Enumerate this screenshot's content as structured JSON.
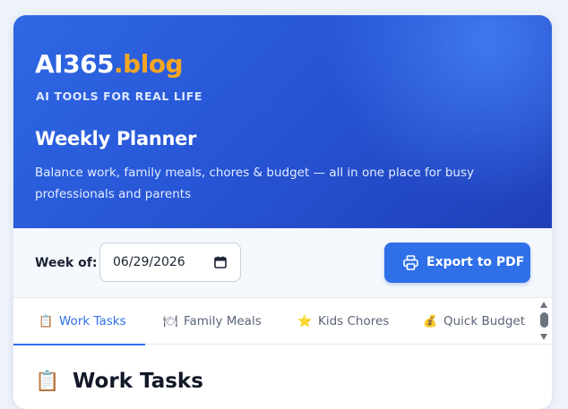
{
  "brand": {
    "name_main": "AI365",
    "name_accent": ".blog",
    "tagline": "AI TOOLS FOR REAL LIFE",
    "accent_color": "#f5a623"
  },
  "hero": {
    "title": "Weekly Planner",
    "subtitle": "Balance work, family meals, chores & budget — all in one place for busy professionals and parents"
  },
  "toolbar": {
    "week_label": "Week of:",
    "date_value": "06/29/2026",
    "export_label": "Export to PDF",
    "primary_color": "#2f6fe8"
  },
  "tabs": [
    {
      "icon": "📋",
      "icon_name": "clipboard-icon",
      "label": "Work Tasks",
      "active": true
    },
    {
      "icon": "🍽",
      "icon_name": "plate-icon",
      "label": "Family Meals",
      "active": false
    },
    {
      "icon": "⭐",
      "icon_name": "star-icon",
      "label": "Kids Chores",
      "active": false
    },
    {
      "icon": "💰",
      "icon_name": "money-bag-icon",
      "label": "Quick Budget",
      "active": false
    }
  ],
  "section": {
    "icon": "📋",
    "title": "Work Tasks"
  }
}
